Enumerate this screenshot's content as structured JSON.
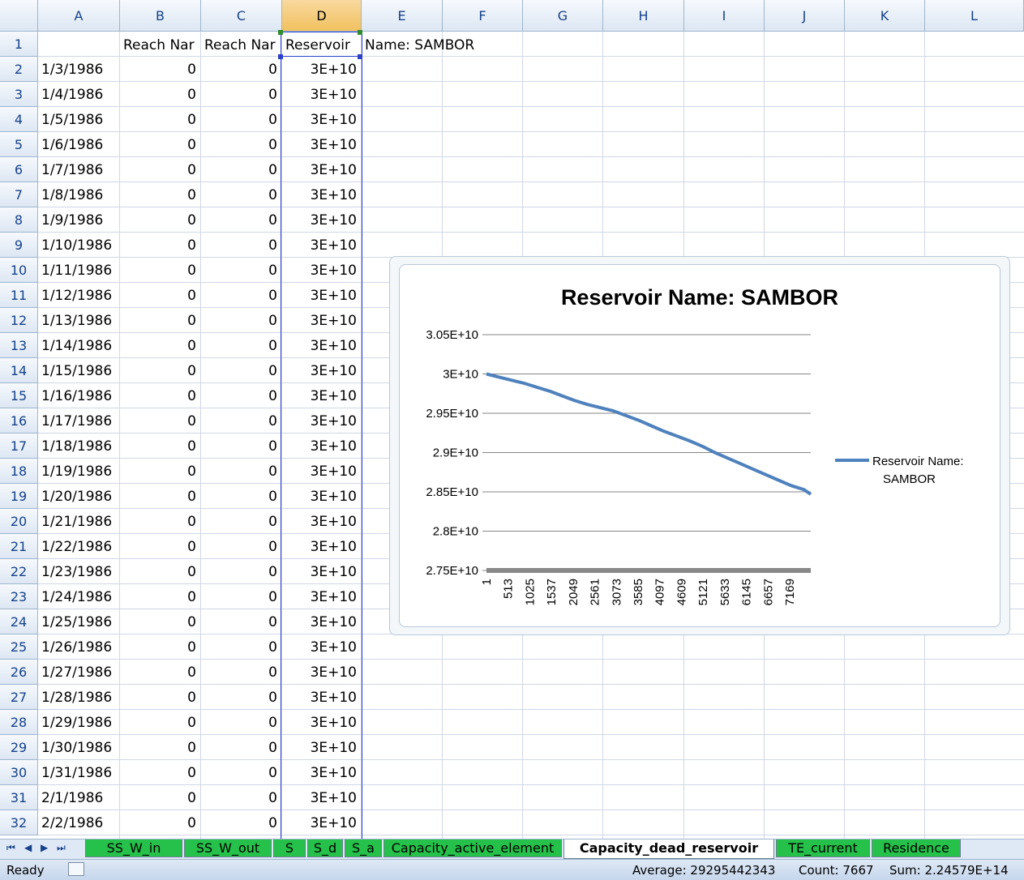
{
  "columns": [
    "A",
    "B",
    "C",
    "D",
    "E",
    "F",
    "G",
    "H",
    "I",
    "J",
    "K",
    "L"
  ],
  "row1": {
    "B": "Reach Nar",
    "C": "Reach Nar",
    "D": "Reservoir",
    "E": "Name: SAMBOR"
  },
  "rows": [
    {
      "n": "2",
      "a": "1/3/1986",
      "b": "0",
      "c": "0",
      "d": "3E+10"
    },
    {
      "n": "3",
      "a": "1/4/1986",
      "b": "0",
      "c": "0",
      "d": "3E+10"
    },
    {
      "n": "4",
      "a": "1/5/1986",
      "b": "0",
      "c": "0",
      "d": "3E+10"
    },
    {
      "n": "5",
      "a": "1/6/1986",
      "b": "0",
      "c": "0",
      "d": "3E+10"
    },
    {
      "n": "6",
      "a": "1/7/1986",
      "b": "0",
      "c": "0",
      "d": "3E+10"
    },
    {
      "n": "7",
      "a": "1/8/1986",
      "b": "0",
      "c": "0",
      "d": "3E+10"
    },
    {
      "n": "8",
      "a": "1/9/1986",
      "b": "0",
      "c": "0",
      "d": "3E+10"
    },
    {
      "n": "9",
      "a": "1/10/1986",
      "b": "0",
      "c": "0",
      "d": "3E+10"
    },
    {
      "n": "10",
      "a": "1/11/1986",
      "b": "0",
      "c": "0",
      "d": "3E+10"
    },
    {
      "n": "11",
      "a": "1/12/1986",
      "b": "0",
      "c": "0",
      "d": "3E+10"
    },
    {
      "n": "12",
      "a": "1/13/1986",
      "b": "0",
      "c": "0",
      "d": "3E+10"
    },
    {
      "n": "13",
      "a": "1/14/1986",
      "b": "0",
      "c": "0",
      "d": "3E+10"
    },
    {
      "n": "14",
      "a": "1/15/1986",
      "b": "0",
      "c": "0",
      "d": "3E+10"
    },
    {
      "n": "15",
      "a": "1/16/1986",
      "b": "0",
      "c": "0",
      "d": "3E+10"
    },
    {
      "n": "16",
      "a": "1/17/1986",
      "b": "0",
      "c": "0",
      "d": "3E+10"
    },
    {
      "n": "17",
      "a": "1/18/1986",
      "b": "0",
      "c": "0",
      "d": "3E+10"
    },
    {
      "n": "18",
      "a": "1/19/1986",
      "b": "0",
      "c": "0",
      "d": "3E+10"
    },
    {
      "n": "19",
      "a": "1/20/1986",
      "b": "0",
      "c": "0",
      "d": "3E+10"
    },
    {
      "n": "20",
      "a": "1/21/1986",
      "b": "0",
      "c": "0",
      "d": "3E+10"
    },
    {
      "n": "21",
      "a": "1/22/1986",
      "b": "0",
      "c": "0",
      "d": "3E+10"
    },
    {
      "n": "22",
      "a": "1/23/1986",
      "b": "0",
      "c": "0",
      "d": "3E+10"
    },
    {
      "n": "23",
      "a": "1/24/1986",
      "b": "0",
      "c": "0",
      "d": "3E+10"
    },
    {
      "n": "24",
      "a": "1/25/1986",
      "b": "0",
      "c": "0",
      "d": "3E+10"
    },
    {
      "n": "25",
      "a": "1/26/1986",
      "b": "0",
      "c": "0",
      "d": "3E+10"
    },
    {
      "n": "26",
      "a": "1/27/1986",
      "b": "0",
      "c": "0",
      "d": "3E+10"
    },
    {
      "n": "27",
      "a": "1/28/1986",
      "b": "0",
      "c": "0",
      "d": "3E+10"
    },
    {
      "n": "28",
      "a": "1/29/1986",
      "b": "0",
      "c": "0",
      "d": "3E+10"
    },
    {
      "n": "29",
      "a": "1/30/1986",
      "b": "0",
      "c": "0",
      "d": "3E+10"
    },
    {
      "n": "30",
      "a": "1/31/1986",
      "b": "0",
      "c": "0",
      "d": "3E+10"
    },
    {
      "n": "31",
      "a": "2/1/1986",
      "b": "0",
      "c": "0",
      "d": "3E+10"
    },
    {
      "n": "32",
      "a": "2/2/1986",
      "b": "0",
      "c": "0",
      "d": "3E+10"
    }
  ],
  "chart_data": {
    "type": "line",
    "title": "Reservoir Name: SAMBOR",
    "xlabel": "",
    "ylabel": "",
    "ylim": [
      27500000000.0,
      30500000000.0
    ],
    "y_ticks": [
      "3.05E+10",
      "3E+10",
      "2.95E+10",
      "2.9E+10",
      "2.85E+10",
      "2.8E+10",
      "2.75E+10"
    ],
    "x_ticks": [
      "1",
      "513",
      "1025",
      "1537",
      "2049",
      "2561",
      "3073",
      "3585",
      "4097",
      "4609",
      "5121",
      "5633",
      "6145",
      "6657",
      "7169"
    ],
    "xlim": [
      1,
      7667
    ],
    "series": [
      {
        "name": "Reservoir Name: SAMBOR",
        "color": "#4f81bd",
        "x": [
          1,
          300,
          600,
          900,
          1200,
          1500,
          1800,
          2100,
          2400,
          2700,
          3000,
          3300,
          3600,
          3900,
          4200,
          4500,
          4800,
          5100,
          5400,
          5700,
          6000,
          6300,
          6600,
          6900,
          7200,
          7500,
          7667
        ],
        "values": [
          30000000000.0,
          29960000000.0,
          29920000000.0,
          29880000000.0,
          29830000000.0,
          29780000000.0,
          29720000000.0,
          29660000000.0,
          29610000000.0,
          29570000000.0,
          29530000000.0,
          29470000000.0,
          29410000000.0,
          29340000000.0,
          29270000000.0,
          29210000000.0,
          29150000000.0,
          29080000000.0,
          29000000000.0,
          28930000000.0,
          28860000000.0,
          28790000000.0,
          28720000000.0,
          28650000000.0,
          28580000000.0,
          28530000000.0,
          28470000000.0
        ]
      }
    ],
    "legend": "right",
    "grid": true
  },
  "tabs": [
    "SS_W_in",
    "SS_W_out",
    "S",
    "S_d",
    "S_a",
    "Capacity_active_element",
    "Capacity_dead_reservoir",
    "TE_current",
    "Residence"
  ],
  "active_tab": "Capacity_dead_reservoir",
  "status": {
    "ready": "Ready",
    "average": "Average: 29295442343",
    "count": "Count: 7667",
    "sum": "Sum: 2.24579E+14"
  }
}
